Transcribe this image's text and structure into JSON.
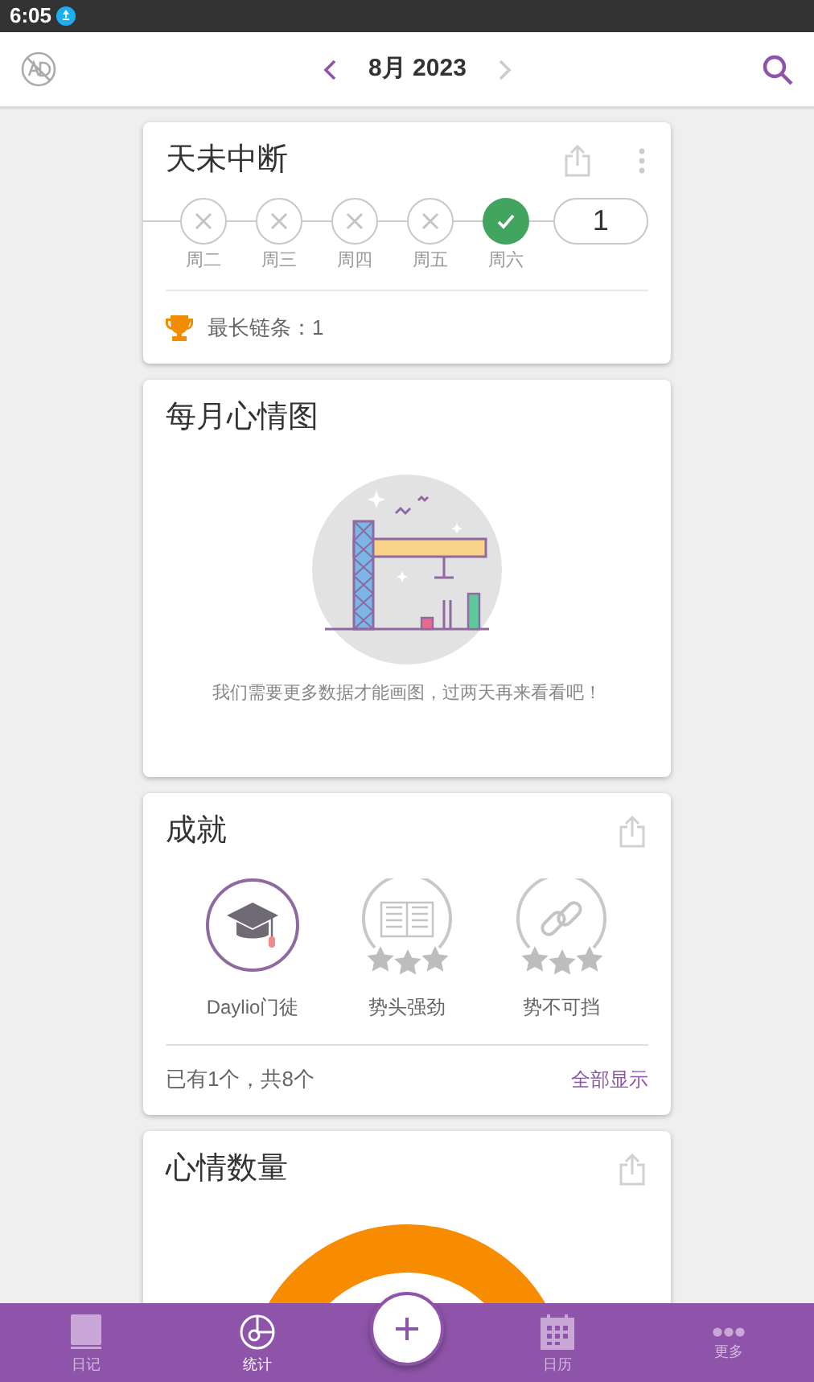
{
  "status_bar": {
    "time": "6:05"
  },
  "header": {
    "month": "8月 2023"
  },
  "streak_card": {
    "title": "天未中断",
    "days": [
      {
        "label": "周二",
        "checked": false
      },
      {
        "label": "周三",
        "checked": false
      },
      {
        "label": "周四",
        "checked": false
      },
      {
        "label": "周五",
        "checked": false
      },
      {
        "label": "周六",
        "checked": true
      }
    ],
    "count": "1",
    "longest": "最长链条：1"
  },
  "mood_chart_card": {
    "title": "每月心情图",
    "message": "我们需要更多数据才能画图，过两天再来看看吧！"
  },
  "achievements_card": {
    "title": "成就",
    "items": [
      {
        "kind": "graduate",
        "label": "Daylio门徒",
        "unlocked": true
      },
      {
        "kind": "book",
        "label": "势头强劲",
        "unlocked": false,
        "stars": 0
      },
      {
        "kind": "chain",
        "label": "势不可挡",
        "unlocked": false,
        "stars": 0
      }
    ],
    "summary": "已有1个，共8个",
    "show_all": "全部显示"
  },
  "mood_count_card": {
    "title": "心情数量"
  },
  "bottom_nav": [
    {
      "kind": "book",
      "label": "日记",
      "selected": false
    },
    {
      "kind": "stats",
      "label": "统计",
      "selected": true
    },
    {
      "kind": "calendar",
      "label": "日历",
      "selected": false
    },
    {
      "kind": "more",
      "label": "更多",
      "selected": false
    }
  ]
}
